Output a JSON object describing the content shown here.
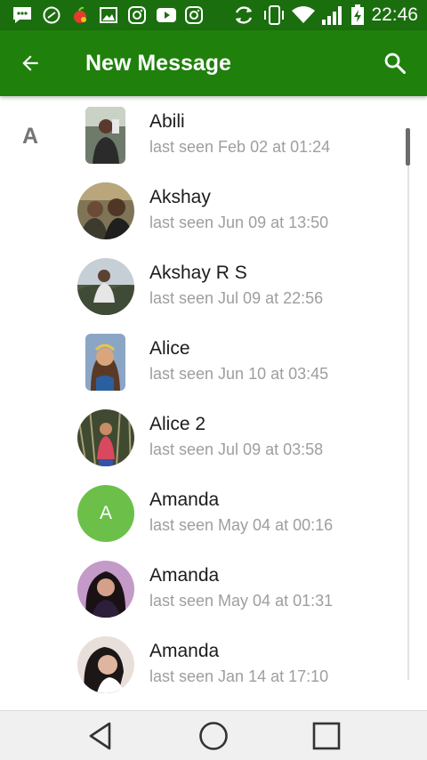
{
  "status_bar": {
    "time": "22:46",
    "icons": [
      "messenger-icon",
      "whatsapp-icon",
      "fruit-app-icon",
      "gallery-icon",
      "instagram-icon",
      "youtube-icon",
      "instagram-icon",
      "sync-icon",
      "vibrate-icon",
      "wifi-icon",
      "signal-icon",
      "battery-charging-icon"
    ]
  },
  "app_bar": {
    "title": "New Message",
    "back_icon": "arrow-back-icon",
    "search_icon": "search-icon",
    "color": "#1f800c"
  },
  "section_letter": "A",
  "contacts": [
    {
      "name": "Abili",
      "last_seen": "last seen Feb 02 at 01:24"
    },
    {
      "name": "Akshay",
      "last_seen": "last seen Jun 09 at 13:50"
    },
    {
      "name": "Akshay R S",
      "last_seen": "last seen Jul 09 at 22:56"
    },
    {
      "name": "Alice",
      "last_seen": "last seen Jun 10 at 03:45"
    },
    {
      "name": "Alice 2",
      "last_seen": "last seen Jul 09 at 03:58"
    },
    {
      "name": "Amanda",
      "last_seen": "last seen May 04 at 00:16",
      "initial": "A",
      "avatar_color": "#6cc04a"
    },
    {
      "name": "Amanda",
      "last_seen": "last seen May 04 at 01:31"
    },
    {
      "name": "Amanda",
      "last_seen": "last seen Jan 14 at 17:10"
    }
  ],
  "nav_bar": {
    "back": "nav-back-icon",
    "home": "nav-home-icon",
    "recents": "nav-recents-icon"
  }
}
